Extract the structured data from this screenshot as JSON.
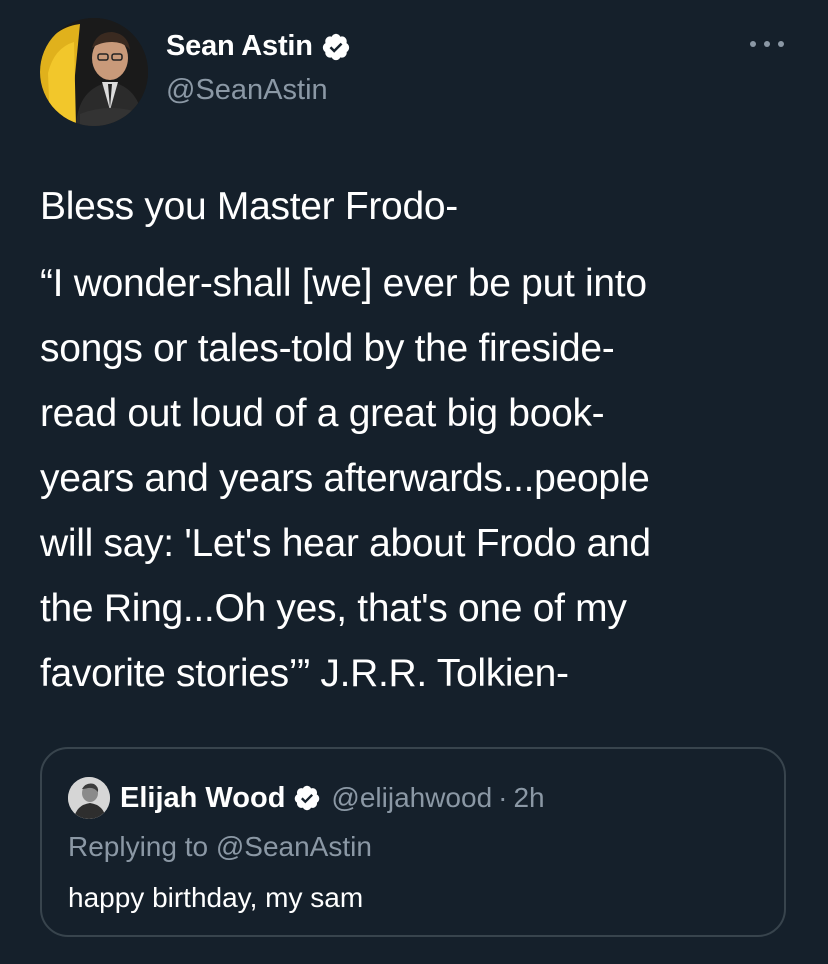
{
  "author": {
    "name": "Sean Astin",
    "handle": "@SeanAstin"
  },
  "tweet": {
    "lines": [
      "Bless you Master Frodo-",
      "“I wonder-shall [we] ever be put into",
      "songs or tales-told by the fireside-",
      "read out loud of a great big book-",
      "years and years afterwards...people",
      "will say: 'Let's hear about Frodo and",
      "the Ring...Oh yes, that's one of my",
      "favorite stories’” J.R.R. Tolkien-"
    ]
  },
  "quoted_tweet": {
    "name": "Elijah Wood",
    "handle": "@elijahwood",
    "separator": "·",
    "time": "2h",
    "replying_to": "Replying to @SeanAstin",
    "text": "happy birthday, my sam"
  },
  "icons": {
    "verified": "verified-badge-icon",
    "more": "more-options-icon"
  },
  "colors": {
    "background": "#15202b",
    "text": "#ffffff",
    "secondary_text": "#8b98a5",
    "border": "#38444d"
  }
}
